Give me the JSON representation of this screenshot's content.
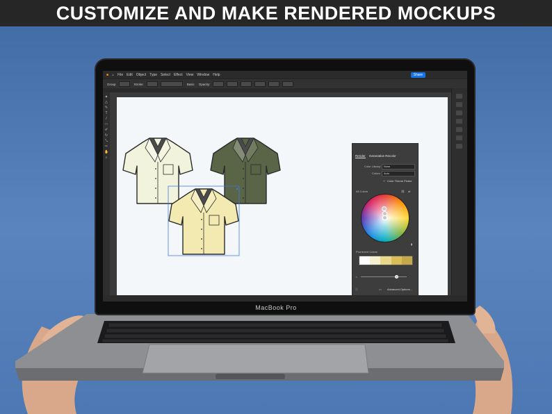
{
  "banner": {
    "title": "CUSTOMIZE AND MAKE RENDERED MOCKUPS"
  },
  "laptop": {
    "brand": "MacBook Pro"
  },
  "app": {
    "menu": [
      "File",
      "Edit",
      "Object",
      "Type",
      "Select",
      "Effect",
      "View",
      "Window",
      "Help"
    ],
    "share_label": "Share",
    "control_bar": [
      "Group",
      "Stroke:",
      "Basic",
      "Opacity:"
    ]
  },
  "panel": {
    "tabs": [
      "Render",
      "Generative Recolor"
    ],
    "color_library_label": "Color Library:",
    "color_library_value": "None",
    "colors_label": "Colors:",
    "colors_value": "Auto",
    "color_theme_picker": "Color Theme Picker",
    "all_colors_label": "All Colors",
    "prominent_colors_label": "Prominent Colors",
    "advanced_options": "Advanced Options...",
    "swatch_colors": [
      "#ffffff",
      "#f3efcf",
      "#e8d98a",
      "#d8be55",
      "#c4a84a"
    ]
  },
  "shirts": [
    {
      "name": "cream",
      "color": "#f2f3dc"
    },
    {
      "name": "olive",
      "color": "#5a6447"
    },
    {
      "name": "yellow",
      "color": "#f3eab2"
    }
  ]
}
